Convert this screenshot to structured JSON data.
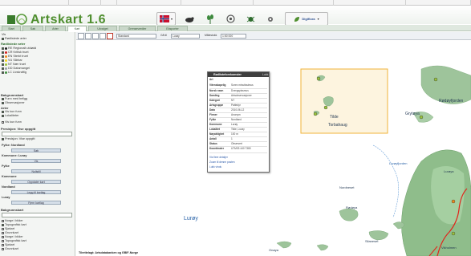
{
  "app": {
    "title": "Artskart 1.6"
  },
  "tabs": [
    {
      "label": "Start",
      "active": false
    },
    {
      "label": "Søk",
      "active": false
    },
    {
      "label": "Arter",
      "active": false
    },
    {
      "label": "Kart",
      "active": true
    },
    {
      "label": "Utvalget",
      "active": false
    },
    {
      "label": "Grenseverdier",
      "active": false
    },
    {
      "label": "Eksporter",
      "active": false
    }
  ],
  "header_tools": {
    "mode": "Digiflora"
  },
  "sidebar": {
    "items": [
      "Vis",
      "Rødlistede arter",
      "RE Regionalt utdødd",
      "CR Kritisk truet",
      "EN Sterkt truet",
      "VU Sårbar",
      "NT Nær truet",
      "DD Datamangel",
      "LC Livskraftig",
      "Funn med beligg",
      "Observasjoner",
      "Arter",
      "Vis kun funn",
      "Lokaliteter",
      "Presisjon: Vise oppgitt",
      "Fylke",
      "Kommune",
      "Nordland",
      "Lurøy",
      "Bakgrunnskart",
      "Norge i bilder",
      "Topografisk kart",
      "Sjøkart",
      "Grunnkart"
    ],
    "buttons": [
      "Søk",
      "Vis",
      "Nullstill",
      "Oppdater kart",
      "Legg til kartlag",
      "Fjern kartlag"
    ],
    "legend": [
      {
        "code": "RE",
        "color": "#222222"
      },
      {
        "code": "CR",
        "color": "#d21f1f"
      },
      {
        "code": "EN",
        "color": "#f08a1b"
      },
      {
        "code": "VU",
        "color": "#f5d21a"
      },
      {
        "code": "NT",
        "color": "#9bc53d"
      },
      {
        "code": "DD",
        "color": "#9aa0a6"
      },
      {
        "code": "LC",
        "color": "#3f8f3f"
      }
    ]
  },
  "map_toolbar": {
    "selects": [
      "Standard",
      "Lurøy"
    ],
    "labels": [
      "Gå til",
      "Målestokk"
    ],
    "scale": "1:50 000"
  },
  "map": {
    "labels": {
      "island1": "Tilde",
      "island2": "Torbahaug",
      "east_place": "Grytøya",
      "east_sea": "Rødøyfjorden",
      "fjord": "Lurøyfjorden",
      "sea": "Lurøy",
      "place3": "Nordneset",
      "place4": "Lurøya",
      "place5": "Rødøya",
      "place6": "Silaneset",
      "place7": "Onøya",
      "place8": "Vikholmen"
    },
    "attribution": "Tilrettelagt: Artsdatabanken og GBIF-Norge",
    "colors": {
      "sea": "#ffffff",
      "land": "#9ec49b",
      "road": "#e2231a",
      "highlight": "#f0b33a"
    }
  },
  "popup": {
    "title": "Rødlisteforekomster",
    "close": "Lukk",
    "subtitle": "Art",
    "rows": [
      {
        "k": "Vitenskapelig",
        "v": "Sorex minutissimus"
      },
      {
        "k": "Norsk navn",
        "v": "Dvergspissmus"
      },
      {
        "k": "Samling",
        "v": "Artsobservasjoner"
      },
      {
        "k": "Kategori",
        "v": "NT"
      },
      {
        "k": "Artsgruppe",
        "v": "Pattedyr"
      },
      {
        "k": "Dato",
        "v": "2010-06-12"
      },
      {
        "k": "Finner",
        "v": "Anonym"
      },
      {
        "k": "Fylke",
        "v": "Nordland"
      },
      {
        "k": "Kommune",
        "v": "Lurøy"
      },
      {
        "k": "Lokalitet",
        "v": "Tilde, Lurøy"
      },
      {
        "k": "Nøyaktighet",
        "v": "100 m"
      },
      {
        "k": "Antall",
        "v": "1"
      },
      {
        "k": "Status",
        "v": "Observert"
      },
      {
        "k": "Koordinater",
        "v": "UTM33 440 7380"
      }
    ],
    "links": [
      "Vis flere detaljer",
      "Zoom til denne posten",
      "Lukk vindu"
    ]
  }
}
